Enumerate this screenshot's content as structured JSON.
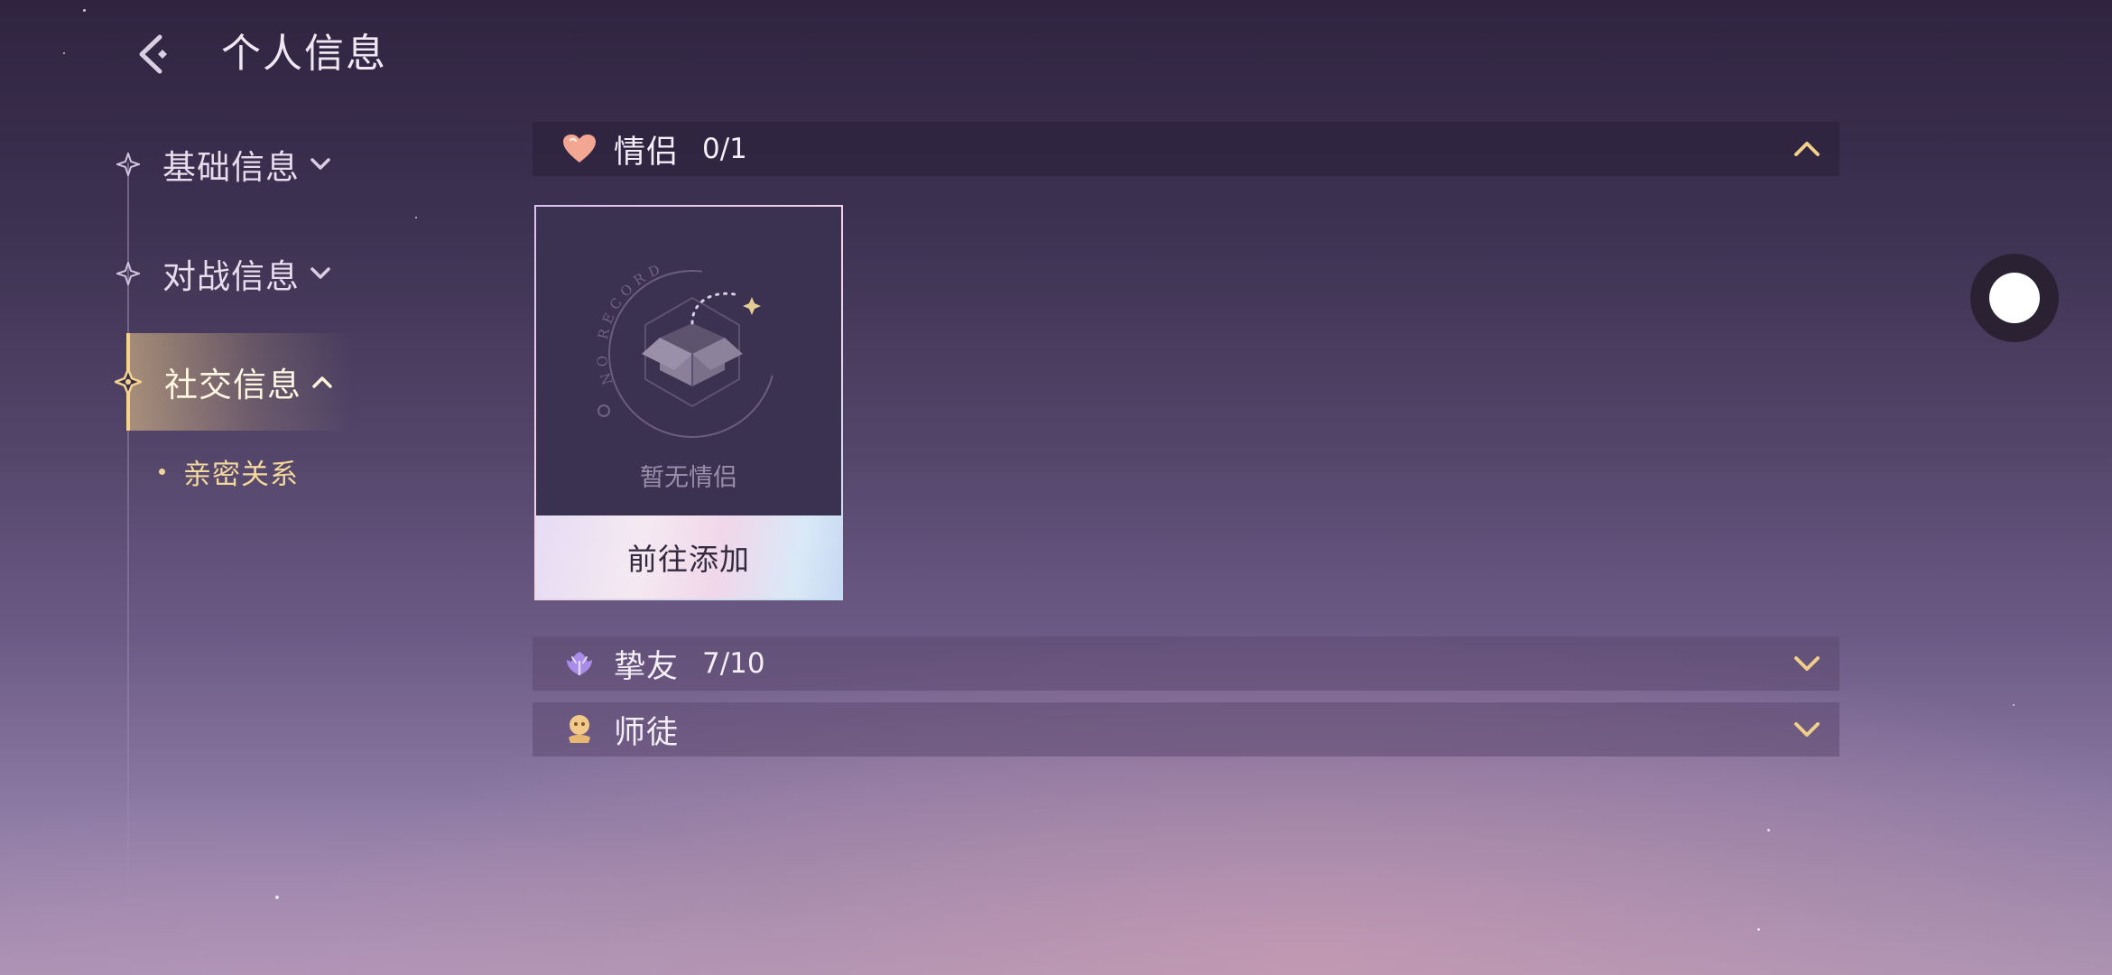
{
  "header": {
    "title": "个人信息"
  },
  "nav": {
    "items": [
      {
        "label": "基础信息"
      },
      {
        "label": "对战信息"
      },
      {
        "label": "社交信息"
      }
    ],
    "sub_items": [
      {
        "label": "亲密关系"
      }
    ]
  },
  "sections": {
    "couple": {
      "title": "情侣",
      "count": "0/1",
      "expanded": true
    },
    "friends": {
      "title": "挚友",
      "count": "7/10",
      "expanded": false
    },
    "mentor": {
      "title": "师徒",
      "expanded": false
    }
  },
  "couple_card": {
    "empty_text": "暂无情侣",
    "arc_text": "NO RECORD",
    "button_label": "前往添加"
  },
  "colors": {
    "accent_gold": "#f3d38d",
    "heart": "#f1a38c",
    "friend_icon": "#a98be8"
  }
}
